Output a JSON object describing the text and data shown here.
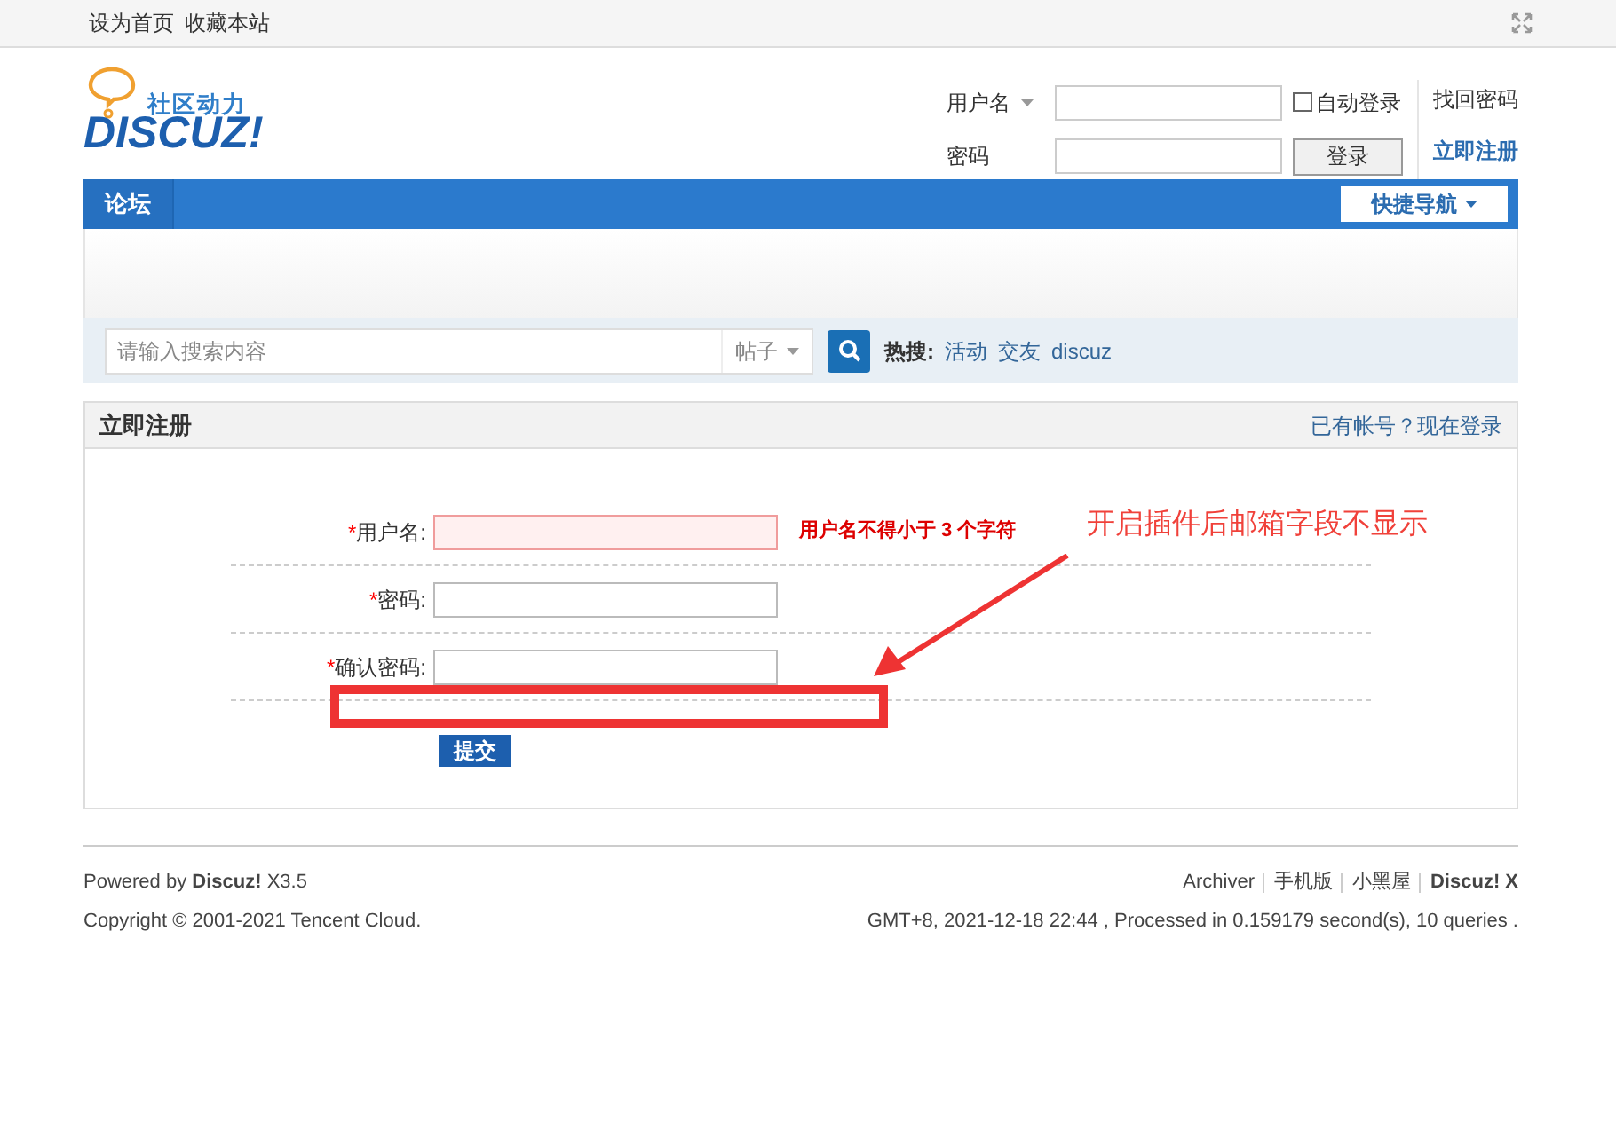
{
  "topbar": {
    "links": [
      "设为首页",
      "收藏本站"
    ]
  },
  "logo": {
    "tagline": "社区动力",
    "wordmark": "DISCUZ!"
  },
  "login": {
    "username_label": "用户名",
    "password_label": "密码",
    "remember": {
      "label": "自动登录",
      "checked": false
    },
    "login_button": "登录",
    "links": [
      "找回密码",
      "立即注册"
    ]
  },
  "nav": {
    "items": [
      {
        "label": "论坛",
        "selected": true
      }
    ],
    "quick_nav": "快捷导航"
  },
  "search": {
    "placeholder": "请输入搜索内容",
    "type": "帖子",
    "hot_label": "热搜:",
    "hot": [
      "活动",
      "交友",
      "discuz"
    ]
  },
  "register": {
    "title": "立即注册",
    "login_link": "已有帐号？现在登录",
    "fields": [
      {
        "required_mark": "*",
        "label": "用户名:",
        "error": true,
        "message": "用户名不得小于 3 个字符"
      },
      {
        "required_mark": "*",
        "label": "密码:",
        "error": false
      },
      {
        "required_mark": "*",
        "label": "确认密码:",
        "error": false
      }
    ],
    "submit": "提交"
  },
  "annotation": {
    "text": "开启插件后邮箱字段不显示"
  },
  "footer": {
    "powered": "Powered by **Discuz!** X3.5",
    "copyright": "Copyright © 2001-2021 Tencent Cloud.",
    "links": [
      "Archiver",
      "手机版",
      "小黑屋",
      "Discuz! X"
    ],
    "info": "GMT+8, 2021-12-18 22:44 , Processed in 0.159179 second(s), 10 queries ."
  }
}
